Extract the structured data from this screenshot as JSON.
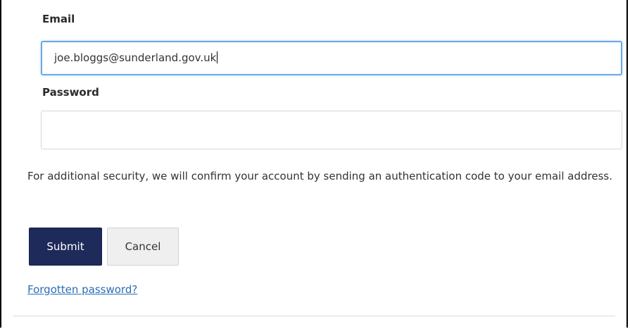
{
  "form": {
    "email_label": "Email",
    "email_value": "joe.bloggs@sunderland.gov.uk",
    "password_label": "Password",
    "password_value": "",
    "help_text": "For additional security, we will confirm your account by sending an authentication code to your email address.",
    "submit_label": "Submit",
    "cancel_label": "Cancel",
    "forgot_link": "Forgotten password?"
  },
  "colors": {
    "submit_bg": "#1e2a5a",
    "link": "#2a6db5",
    "focus_border": "#6aa9e6"
  }
}
